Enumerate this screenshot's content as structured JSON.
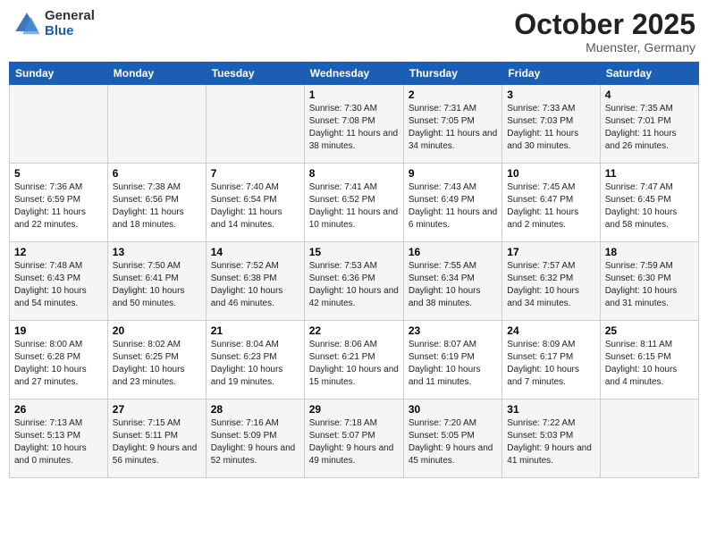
{
  "header": {
    "logo": {
      "general": "General",
      "blue": "Blue"
    },
    "title": "October 2025",
    "location": "Muenster, Germany"
  },
  "weekdays": [
    "Sunday",
    "Monday",
    "Tuesday",
    "Wednesday",
    "Thursday",
    "Friday",
    "Saturday"
  ],
  "weeks": [
    [
      {
        "day": "",
        "info": ""
      },
      {
        "day": "",
        "info": ""
      },
      {
        "day": "",
        "info": ""
      },
      {
        "day": "1",
        "info": "Sunrise: 7:30 AM\nSunset: 7:08 PM\nDaylight: 11 hours\nand 38 minutes."
      },
      {
        "day": "2",
        "info": "Sunrise: 7:31 AM\nSunset: 7:05 PM\nDaylight: 11 hours\nand 34 minutes."
      },
      {
        "day": "3",
        "info": "Sunrise: 7:33 AM\nSunset: 7:03 PM\nDaylight: 11 hours\nand 30 minutes."
      },
      {
        "day": "4",
        "info": "Sunrise: 7:35 AM\nSunset: 7:01 PM\nDaylight: 11 hours\nand 26 minutes."
      }
    ],
    [
      {
        "day": "5",
        "info": "Sunrise: 7:36 AM\nSunset: 6:59 PM\nDaylight: 11 hours\nand 22 minutes."
      },
      {
        "day": "6",
        "info": "Sunrise: 7:38 AM\nSunset: 6:56 PM\nDaylight: 11 hours\nand 18 minutes."
      },
      {
        "day": "7",
        "info": "Sunrise: 7:40 AM\nSunset: 6:54 PM\nDaylight: 11 hours\nand 14 minutes."
      },
      {
        "day": "8",
        "info": "Sunrise: 7:41 AM\nSunset: 6:52 PM\nDaylight: 11 hours\nand 10 minutes."
      },
      {
        "day": "9",
        "info": "Sunrise: 7:43 AM\nSunset: 6:49 PM\nDaylight: 11 hours\nand 6 minutes."
      },
      {
        "day": "10",
        "info": "Sunrise: 7:45 AM\nSunset: 6:47 PM\nDaylight: 11 hours\nand 2 minutes."
      },
      {
        "day": "11",
        "info": "Sunrise: 7:47 AM\nSunset: 6:45 PM\nDaylight: 10 hours\nand 58 minutes."
      }
    ],
    [
      {
        "day": "12",
        "info": "Sunrise: 7:48 AM\nSunset: 6:43 PM\nDaylight: 10 hours\nand 54 minutes."
      },
      {
        "day": "13",
        "info": "Sunrise: 7:50 AM\nSunset: 6:41 PM\nDaylight: 10 hours\nand 50 minutes."
      },
      {
        "day": "14",
        "info": "Sunrise: 7:52 AM\nSunset: 6:38 PM\nDaylight: 10 hours\nand 46 minutes."
      },
      {
        "day": "15",
        "info": "Sunrise: 7:53 AM\nSunset: 6:36 PM\nDaylight: 10 hours\nand 42 minutes."
      },
      {
        "day": "16",
        "info": "Sunrise: 7:55 AM\nSunset: 6:34 PM\nDaylight: 10 hours\nand 38 minutes."
      },
      {
        "day": "17",
        "info": "Sunrise: 7:57 AM\nSunset: 6:32 PM\nDaylight: 10 hours\nand 34 minutes."
      },
      {
        "day": "18",
        "info": "Sunrise: 7:59 AM\nSunset: 6:30 PM\nDaylight: 10 hours\nand 31 minutes."
      }
    ],
    [
      {
        "day": "19",
        "info": "Sunrise: 8:00 AM\nSunset: 6:28 PM\nDaylight: 10 hours\nand 27 minutes."
      },
      {
        "day": "20",
        "info": "Sunrise: 8:02 AM\nSunset: 6:25 PM\nDaylight: 10 hours\nand 23 minutes."
      },
      {
        "day": "21",
        "info": "Sunrise: 8:04 AM\nSunset: 6:23 PM\nDaylight: 10 hours\nand 19 minutes."
      },
      {
        "day": "22",
        "info": "Sunrise: 8:06 AM\nSunset: 6:21 PM\nDaylight: 10 hours\nand 15 minutes."
      },
      {
        "day": "23",
        "info": "Sunrise: 8:07 AM\nSunset: 6:19 PM\nDaylight: 10 hours\nand 11 minutes."
      },
      {
        "day": "24",
        "info": "Sunrise: 8:09 AM\nSunset: 6:17 PM\nDaylight: 10 hours\nand 7 minutes."
      },
      {
        "day": "25",
        "info": "Sunrise: 8:11 AM\nSunset: 6:15 PM\nDaylight: 10 hours\nand 4 minutes."
      }
    ],
    [
      {
        "day": "26",
        "info": "Sunrise: 7:13 AM\nSunset: 5:13 PM\nDaylight: 10 hours\nand 0 minutes."
      },
      {
        "day": "27",
        "info": "Sunrise: 7:15 AM\nSunset: 5:11 PM\nDaylight: 9 hours\nand 56 minutes."
      },
      {
        "day": "28",
        "info": "Sunrise: 7:16 AM\nSunset: 5:09 PM\nDaylight: 9 hours\nand 52 minutes."
      },
      {
        "day": "29",
        "info": "Sunrise: 7:18 AM\nSunset: 5:07 PM\nDaylight: 9 hours\nand 49 minutes."
      },
      {
        "day": "30",
        "info": "Sunrise: 7:20 AM\nSunset: 5:05 PM\nDaylight: 9 hours\nand 45 minutes."
      },
      {
        "day": "31",
        "info": "Sunrise: 7:22 AM\nSunset: 5:03 PM\nDaylight: 9 hours\nand 41 minutes."
      },
      {
        "day": "",
        "info": ""
      }
    ]
  ]
}
